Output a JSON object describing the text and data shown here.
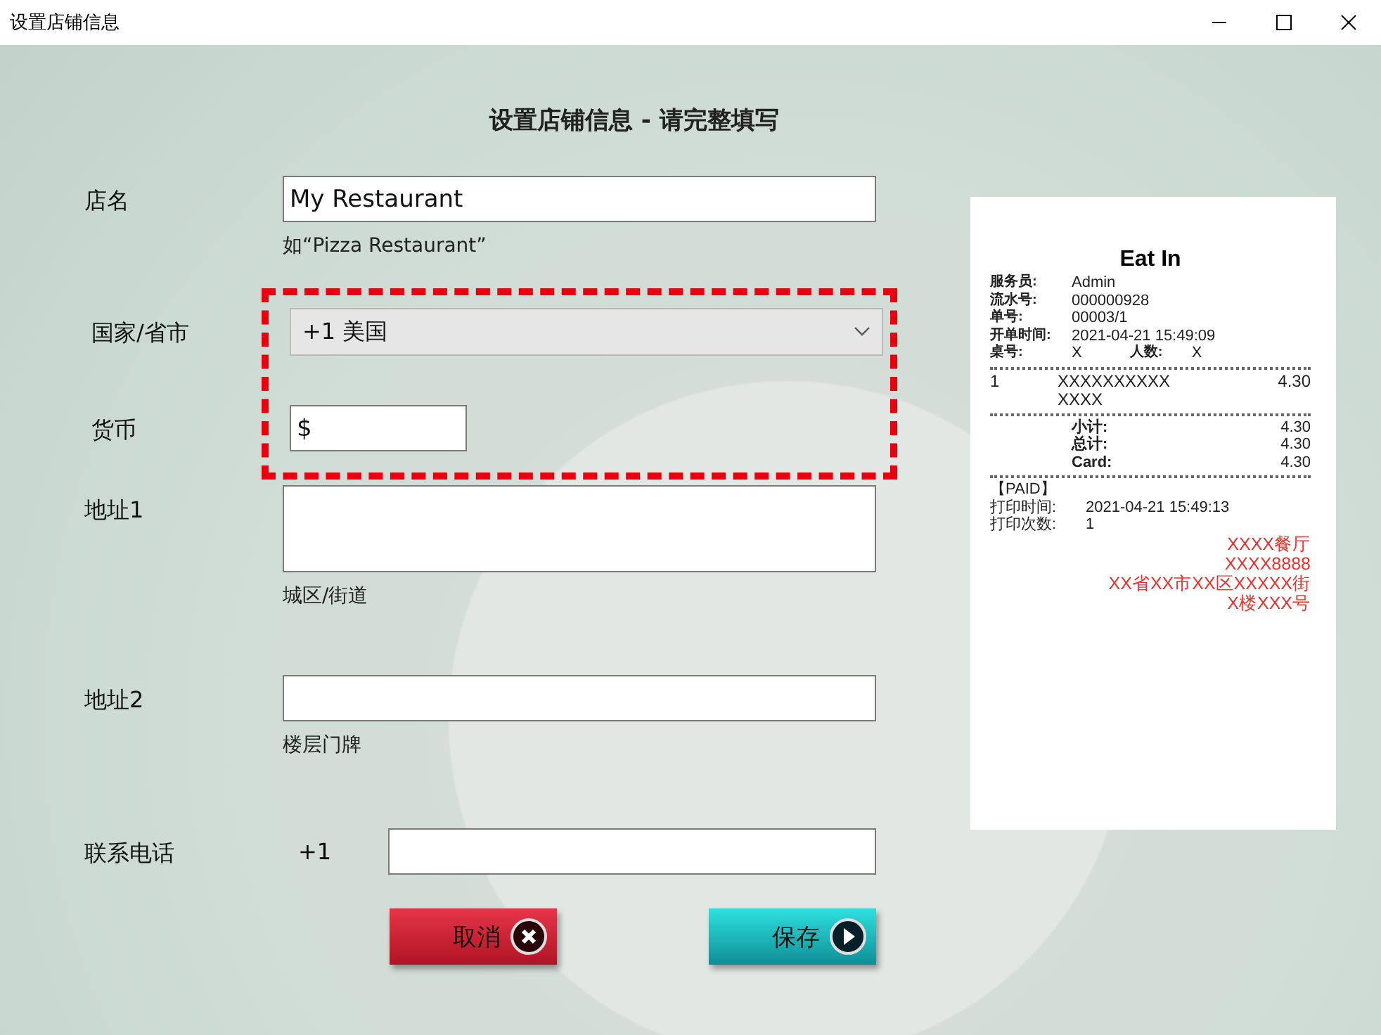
{
  "window": {
    "title": "设置店铺信息"
  },
  "heading": "设置店铺信息 - 请完整填写",
  "sections": [
    {
      "highlighted": false,
      "fields": [
        {
          "kind": "text",
          "label": "店名",
          "value": "My Restaurant",
          "hint": "如“Pizza Restaurant”"
        }
      ]
    },
    {
      "highlighted": true,
      "fields": [
        {
          "kind": "select",
          "label": "国家/省市",
          "value": "+1 美国"
        },
        {
          "kind": "short",
          "label": "货币",
          "value": "$"
        }
      ]
    },
    {
      "highlighted": false,
      "fields": [
        {
          "kind": "area",
          "label": "地址1",
          "hint": "城区/街道"
        },
        {
          "kind": "text",
          "label": "地址2",
          "hint": "楼层门牌"
        },
        {
          "kind": "phone",
          "label": "联系电话",
          "prefix": "+1"
        }
      ]
    }
  ],
  "buttons": [
    {
      "kind": "cancel",
      "label": "取消"
    },
    {
      "kind": "save",
      "label": "保存"
    }
  ],
  "receipt": {
    "title": "Eat In",
    "info": [
      {
        "label": "服务员:",
        "value": "Admin"
      },
      {
        "label": "流水号:",
        "value": "000000928"
      },
      {
        "label": "单号:",
        "value": "00003/1"
      },
      {
        "label": "开单时间:",
        "value": "2021-04-21 15:49:09"
      },
      {
        "label": "桌号:",
        "value": "X",
        "label2": "人数:",
        "value2": "X"
      }
    ],
    "items": [
      {
        "qty": "1",
        "name": "XXXXXXXXXX",
        "price": "4.30"
      },
      {
        "name": "XXXX"
      }
    ],
    "totals": [
      {
        "label": "小计:",
        "value": "4.30"
      },
      {
        "label": "总计:",
        "value": "4.30"
      },
      {
        "label": "Card:",
        "value": "4.30"
      }
    ],
    "status": "【PAID】",
    "print_info": [
      {
        "label": "打印时间:",
        "value": "2021-04-21 15:49:13"
      },
      {
        "label": "打印次数:",
        "value": "1"
      }
    ],
    "footer": [
      "XXXX餐厅",
      "XXXX8888",
      "XX省XX市XX区XXXXX街",
      "X楼XXX号"
    ]
  }
}
